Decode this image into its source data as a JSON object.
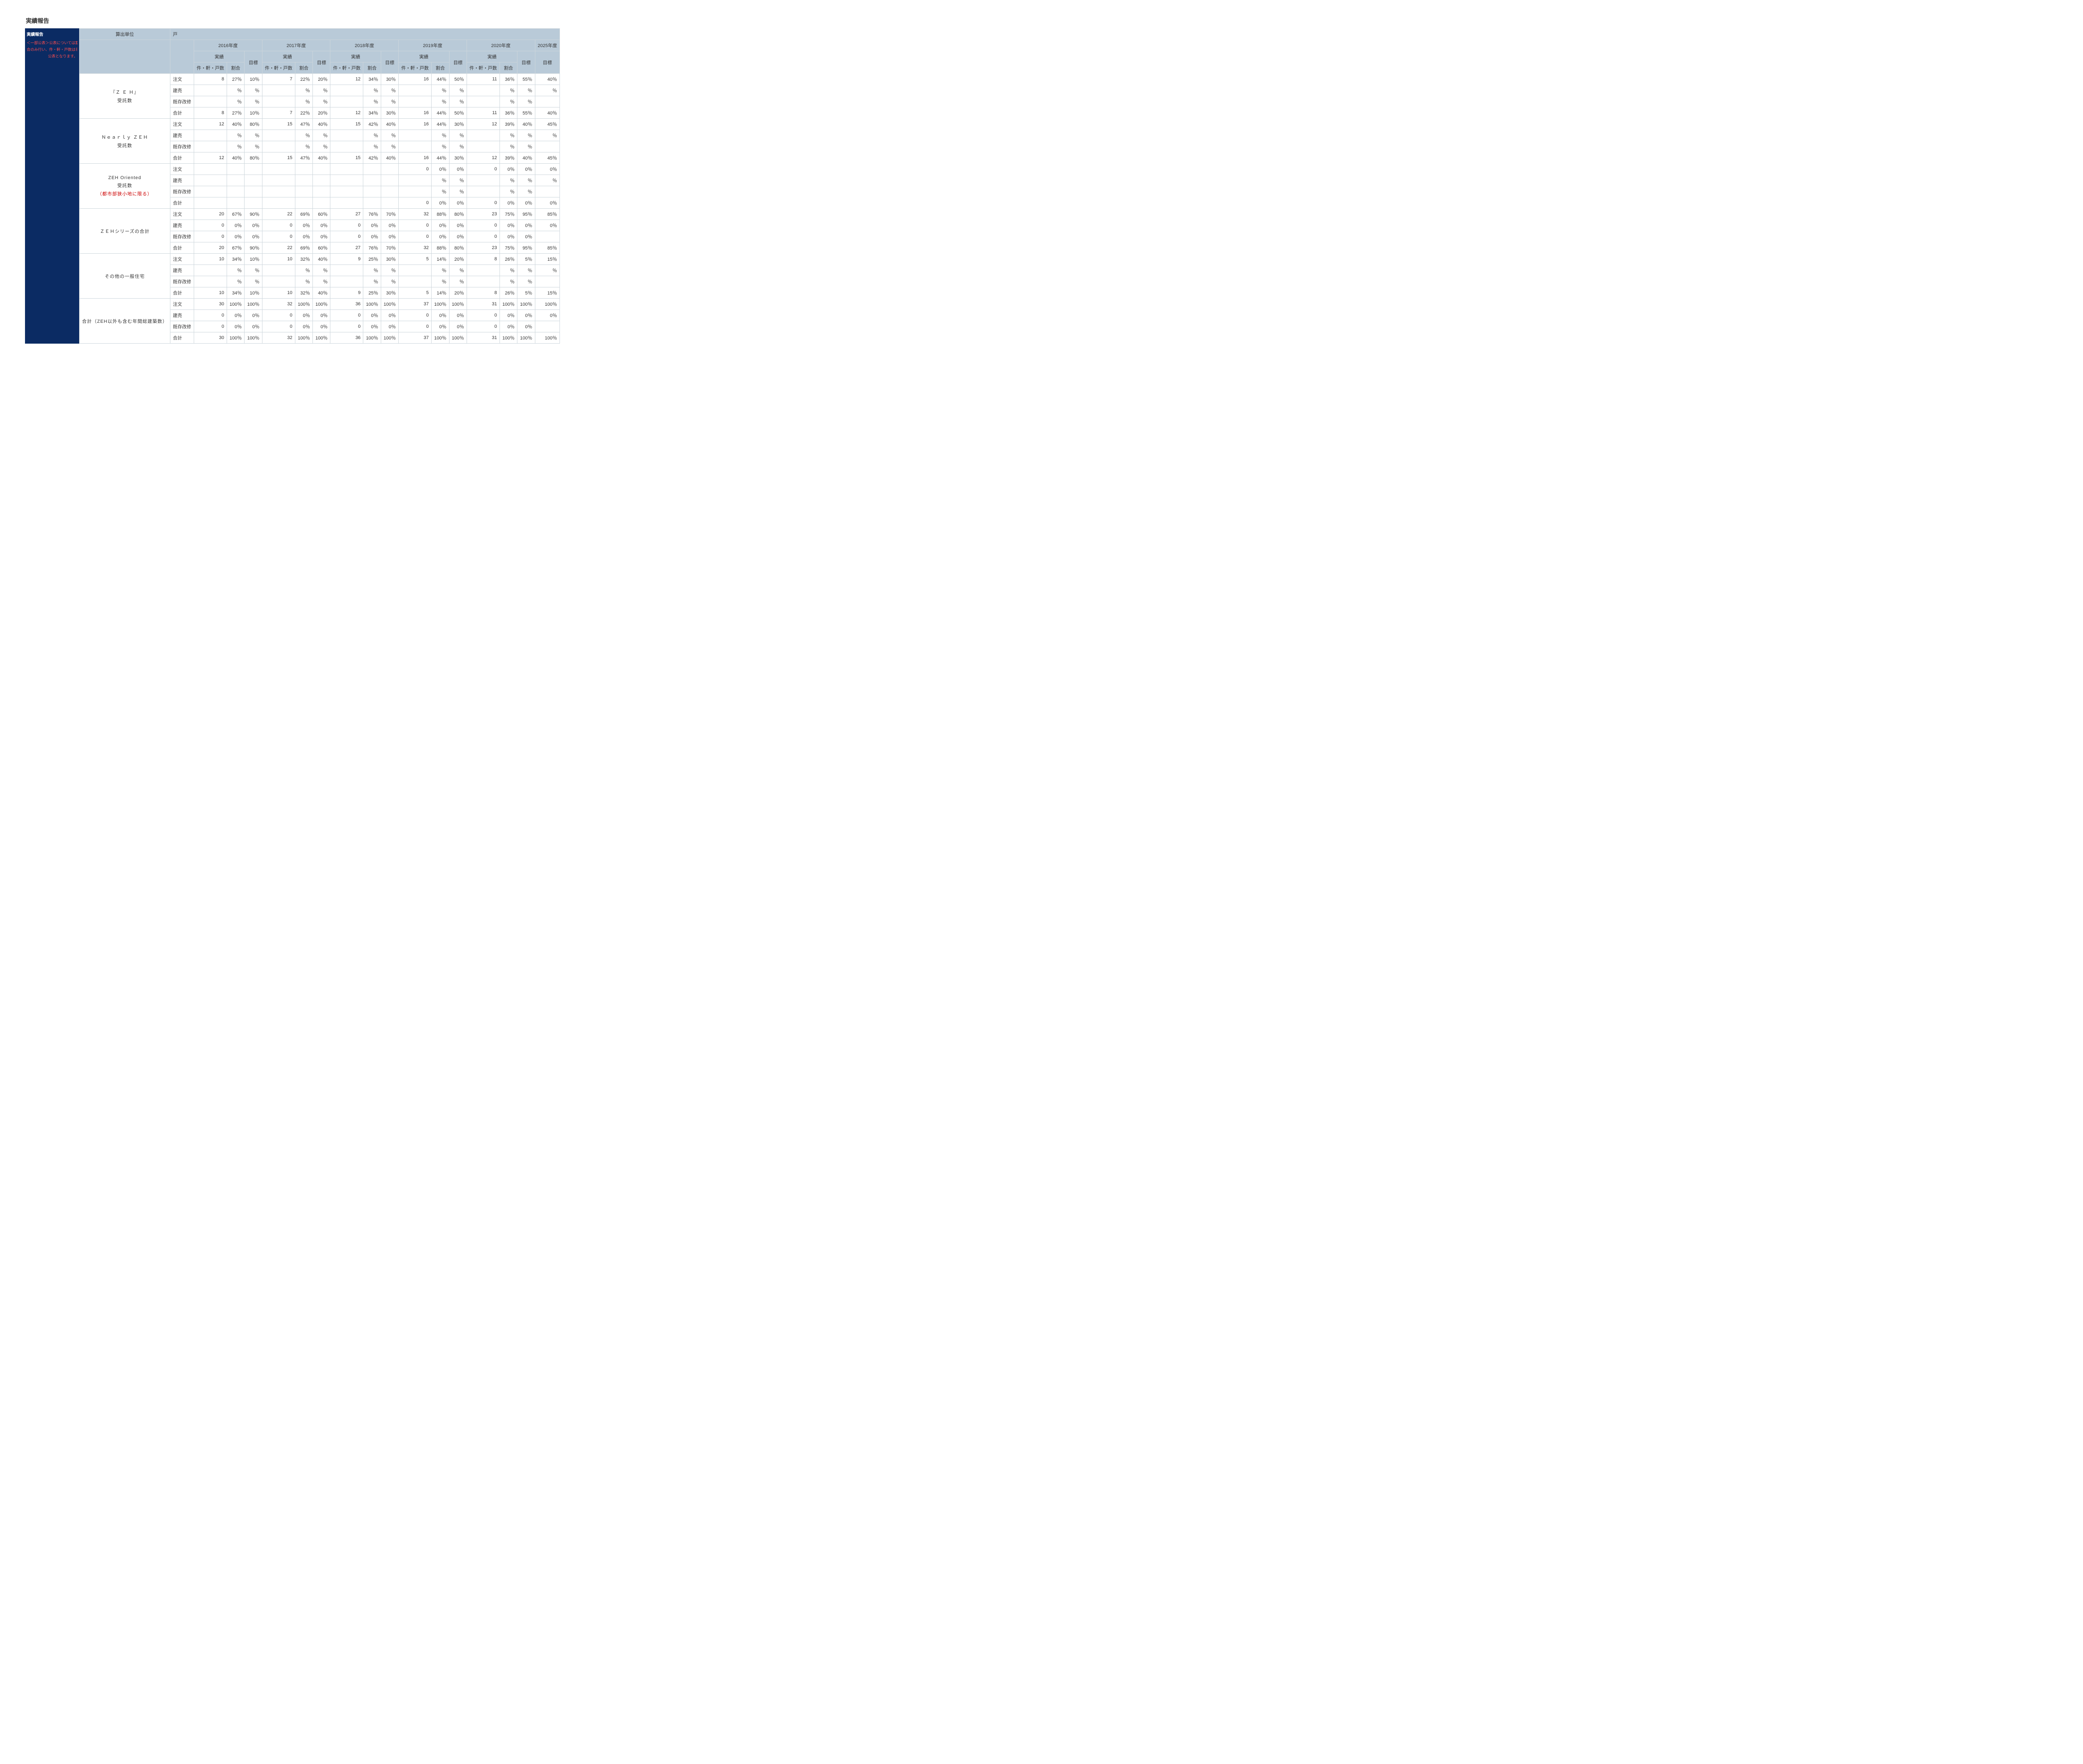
{
  "page_title": "実績報告",
  "sidebar": {
    "title": "実績報告",
    "note_prefix": "＜一部公表＞公表については割",
    "note_mid": "合のみ行い、件・軒・戸数は非",
    "note_suffix": "公表となります。"
  },
  "unit_row": {
    "label": "算出単位",
    "value": "戸"
  },
  "header": {
    "years": [
      "2016年度",
      "2017年度",
      "2018年度",
      "2019年度",
      "2020年度",
      "2025年度"
    ],
    "sub_actual": "実績",
    "sub_target": "目標",
    "col_count": "件・軒・戸数",
    "col_ratio": "割合"
  },
  "types": {
    "chumon": "注文",
    "tateuri": "建売",
    "kizon": "既存改修",
    "gokei": "合計"
  },
  "categories": [
    {
      "key": "zeh",
      "title": "『Ｚ Ｅ Ｈ』",
      "sub": "受託数",
      "note": ""
    },
    {
      "key": "nearly",
      "title": "Ｎｅａｒｌｙ ＺＥＨ",
      "sub": "受託数",
      "note": ""
    },
    {
      "key": "oriented",
      "title": "ZEH Oriented",
      "sub": "受託数",
      "note": "（都市部狭小地に限る）"
    },
    {
      "key": "series",
      "title": "ＺＥＨシリーズの合計",
      "sub": "",
      "note": ""
    },
    {
      "key": "other",
      "title": "その他の一般住宅",
      "sub": "",
      "note": ""
    },
    {
      "key": "total",
      "title": "合計（ZEH以外も含む年間総建築数）",
      "sub": "",
      "note": ""
    }
  ],
  "chart_data": {
    "type": "table",
    "years": [
      "2016",
      "2017",
      "2018",
      "2019",
      "2020",
      "2025"
    ],
    "data": {
      "zeh": {
        "chumon": {
          "n": [
            "8",
            "7",
            "12",
            "16",
            "11",
            ""
          ],
          "p": [
            "27％",
            "22％",
            "34％",
            "44％",
            "36％",
            ""
          ],
          "t": [
            "10％",
            "20％",
            "30％",
            "50％",
            "55％",
            "40％"
          ]
        },
        "tateuri": {
          "n": [
            "",
            "",
            "",
            "",
            "",
            ""
          ],
          "p": [
            "％",
            "％",
            "％",
            "％",
            "％",
            ""
          ],
          "t": [
            "％",
            "％",
            "％",
            "％",
            "％",
            "％"
          ]
        },
        "kizon": {
          "n": [
            "",
            "",
            "",
            "",
            "",
            ""
          ],
          "p": [
            "％",
            "％",
            "％",
            "％",
            "％",
            ""
          ],
          "t": [
            "％",
            "％",
            "％",
            "％",
            "％",
            ""
          ]
        },
        "gokei": {
          "n": [
            "8",
            "7",
            "12",
            "16",
            "11",
            ""
          ],
          "p": [
            "27％",
            "22％",
            "34％",
            "44％",
            "36％",
            ""
          ],
          "t": [
            "10％",
            "20％",
            "30％",
            "50％",
            "55％",
            "40％"
          ]
        }
      },
      "nearly": {
        "chumon": {
          "n": [
            "12",
            "15",
            "15",
            "16",
            "12",
            ""
          ],
          "p": [
            "40％",
            "47％",
            "42％",
            "44％",
            "39％",
            ""
          ],
          "t": [
            "80％",
            "40％",
            "40％",
            "30％",
            "40％",
            "45％"
          ]
        },
        "tateuri": {
          "n": [
            "",
            "",
            "",
            "",
            "",
            ""
          ],
          "p": [
            "％",
            "％",
            "％",
            "％",
            "％",
            ""
          ],
          "t": [
            "％",
            "％",
            "％",
            "％",
            "％",
            "％"
          ]
        },
        "kizon": {
          "n": [
            "",
            "",
            "",
            "",
            "",
            ""
          ],
          "p": [
            "％",
            "％",
            "％",
            "％",
            "％",
            ""
          ],
          "t": [
            "％",
            "％",
            "％",
            "％",
            "％",
            ""
          ]
        },
        "gokei": {
          "n": [
            "12",
            "15",
            "15",
            "16",
            "12",
            ""
          ],
          "p": [
            "40％",
            "47％",
            "42％",
            "44％",
            "39％",
            ""
          ],
          "t": [
            "80％",
            "40％",
            "40％",
            "30％",
            "40％",
            "45％"
          ]
        }
      },
      "oriented": {
        "chumon": {
          "n": [
            "",
            "",
            "",
            "0",
            "0",
            ""
          ],
          "p": [
            "",
            "",
            "",
            "0％",
            "0％",
            ""
          ],
          "t": [
            "",
            "",
            "",
            "0％",
            "0％",
            "0％"
          ]
        },
        "tateuri": {
          "n": [
            "",
            "",
            "",
            "",
            "",
            ""
          ],
          "p": [
            "",
            "",
            "",
            "％",
            "％",
            ""
          ],
          "t": [
            "",
            "",
            "",
            "％",
            "％",
            "％"
          ]
        },
        "kizon": {
          "n": [
            "",
            "",
            "",
            "",
            "",
            ""
          ],
          "p": [
            "",
            "",
            "",
            "％",
            "％",
            ""
          ],
          "t": [
            "",
            "",
            "",
            "％",
            "％",
            ""
          ]
        },
        "gokei": {
          "n": [
            "",
            "",
            "",
            "0",
            "0",
            ""
          ],
          "p": [
            "",
            "",
            "",
            "0％",
            "0％",
            ""
          ],
          "t": [
            "",
            "",
            "",
            "0％",
            "0％",
            "0％"
          ]
        }
      },
      "series": {
        "chumon": {
          "n": [
            "20",
            "22",
            "27",
            "32",
            "23",
            ""
          ],
          "p": [
            "67％",
            "69％",
            "76％",
            "88％",
            "75％",
            ""
          ],
          "t": [
            "90％",
            "60％",
            "70％",
            "80％",
            "95％",
            "85％"
          ]
        },
        "tateuri": {
          "n": [
            "0",
            "0",
            "0",
            "0",
            "0",
            ""
          ],
          "p": [
            "0％",
            "0％",
            "0％",
            "0％",
            "0％",
            ""
          ],
          "t": [
            "0％",
            "0％",
            "0％",
            "0％",
            "0％",
            "0％"
          ]
        },
        "kizon": {
          "n": [
            "0",
            "0",
            "0",
            "0",
            "0",
            ""
          ],
          "p": [
            "0％",
            "0％",
            "0％",
            "0％",
            "0％",
            ""
          ],
          "t": [
            "0％",
            "0％",
            "0％",
            "0％",
            "0％",
            ""
          ]
        },
        "gokei": {
          "n": [
            "20",
            "22",
            "27",
            "32",
            "23",
            ""
          ],
          "p": [
            "67％",
            "69％",
            "76％",
            "88％",
            "75％",
            ""
          ],
          "t": [
            "90％",
            "60％",
            "70％",
            "80％",
            "95％",
            "85％"
          ]
        }
      },
      "other": {
        "chumon": {
          "n": [
            "10",
            "10",
            "9",
            "5",
            "8",
            ""
          ],
          "p": [
            "34％",
            "32％",
            "25％",
            "14％",
            "26％",
            ""
          ],
          "t": [
            "10％",
            "40％",
            "30％",
            "20％",
            "5％",
            "15％"
          ]
        },
        "tateuri": {
          "n": [
            "",
            "",
            "",
            "",
            "",
            ""
          ],
          "p": [
            "％",
            "％",
            "％",
            "％",
            "％",
            ""
          ],
          "t": [
            "％",
            "％",
            "％",
            "％",
            "％",
            "％"
          ]
        },
        "kizon": {
          "n": [
            "",
            "",
            "",
            "",
            "",
            ""
          ],
          "p": [
            "％",
            "％",
            "％",
            "％",
            "％",
            ""
          ],
          "t": [
            "％",
            "％",
            "％",
            "％",
            "％",
            ""
          ]
        },
        "gokei": {
          "n": [
            "10",
            "10",
            "9",
            "5",
            "8",
            ""
          ],
          "p": [
            "34％",
            "32％",
            "25％",
            "14％",
            "26％",
            ""
          ],
          "t": [
            "10％",
            "40％",
            "30％",
            "20％",
            "5％",
            "15％"
          ]
        }
      },
      "total": {
        "chumon": {
          "n": [
            "30",
            "32",
            "36",
            "37",
            "31",
            ""
          ],
          "p": [
            "100％",
            "100％",
            "100％",
            "100％",
            "100％",
            ""
          ],
          "t": [
            "100％",
            "100％",
            "100％",
            "100％",
            "100％",
            "100％"
          ]
        },
        "tateuri": {
          "n": [
            "0",
            "0",
            "0",
            "0",
            "0",
            ""
          ],
          "p": [
            "0％",
            "0％",
            "0％",
            "0％",
            "0％",
            ""
          ],
          "t": [
            "0％",
            "0％",
            "0％",
            "0％",
            "0％",
            "0％"
          ]
        },
        "kizon": {
          "n": [
            "0",
            "0",
            "0",
            "0",
            "0",
            ""
          ],
          "p": [
            "0％",
            "0％",
            "0％",
            "0％",
            "0％",
            ""
          ],
          "t": [
            "0％",
            "0％",
            "0％",
            "0％",
            "0％",
            ""
          ]
        },
        "gokei": {
          "n": [
            "30",
            "32",
            "36",
            "37",
            "31",
            ""
          ],
          "p": [
            "100％",
            "100％",
            "100％",
            "100％",
            "100％",
            ""
          ],
          "t": [
            "100％",
            "100％",
            "100％",
            "100％",
            "100％",
            "100％"
          ]
        }
      }
    }
  }
}
